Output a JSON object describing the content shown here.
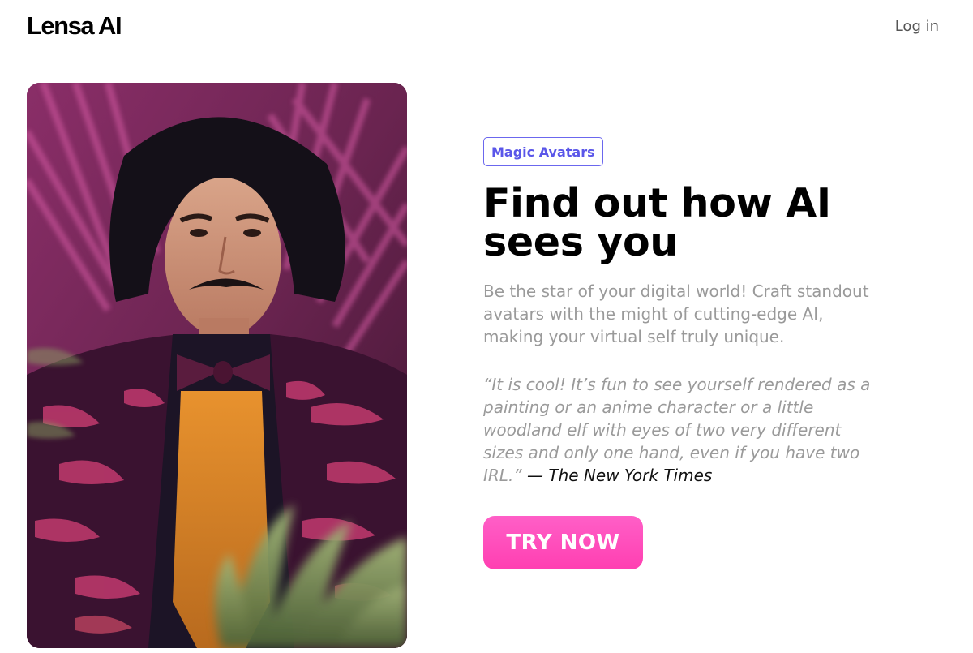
{
  "header": {
    "logo": "Lensa AI",
    "login_label": "Log in"
  },
  "hero": {
    "image_alt": "AI-generated portrait of a man in a patterned pink suit among tropical palm leaves"
  },
  "content": {
    "badge": "Magic Avatars",
    "title": "Find out how AI sees you",
    "description": "Be the star of your digital world! Craft standout avatars with the might of cutting-edge AI, making your virtual self truly unique.",
    "quote_text": "“It is cool! It’s fun to see yourself rendered as a painting or an anime character or a little woodland elf with eyes of two very different sizes and only one hand, even if you have two IRL.”",
    "quote_source": "— The New York Times",
    "cta_label": "TRY NOW"
  },
  "colors": {
    "badge_accent": "#5a56e9",
    "cta_gradient_top": "#ff5fc7",
    "cta_gradient_bottom": "#ff3fb1",
    "muted_text": "#9a9a9a"
  }
}
